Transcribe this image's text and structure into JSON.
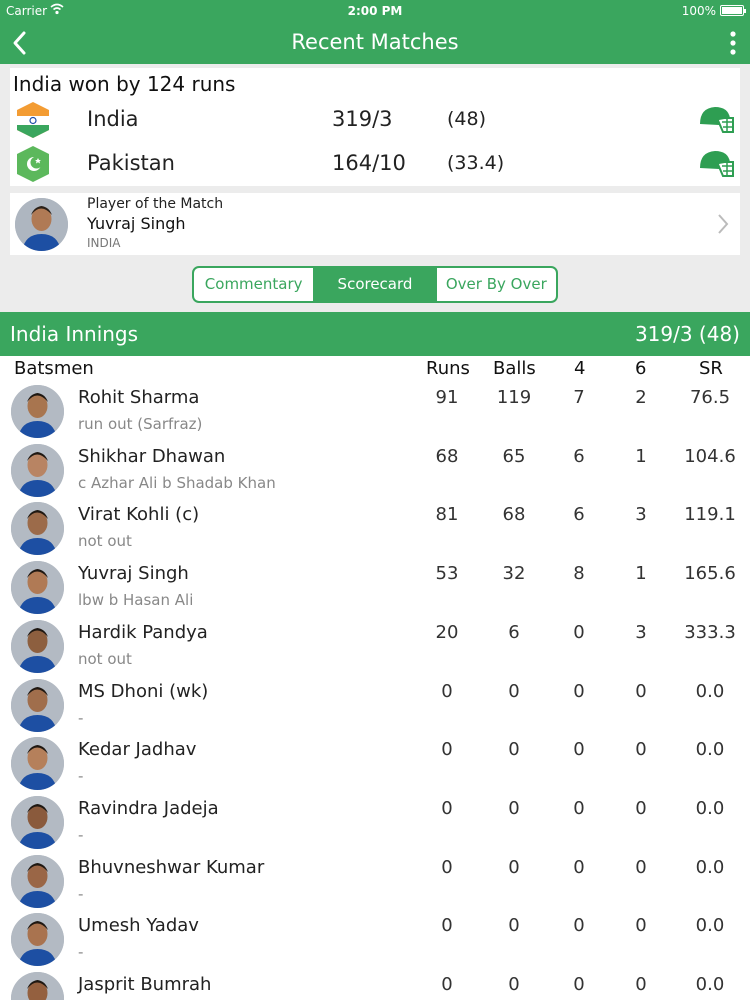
{
  "status_bar": {
    "carrier": "Carrier",
    "time": "2:00 PM",
    "battery": "100%"
  },
  "nav": {
    "title": "Recent Matches"
  },
  "result": {
    "title": "India won by 124 runs",
    "teams": [
      {
        "name": "India",
        "score": "319/3",
        "overs": "(48)"
      },
      {
        "name": "Pakistan",
        "score": "164/10",
        "overs": "(33.4)"
      }
    ]
  },
  "player_of_match": {
    "label": "Player of the Match",
    "name": "Yuvraj Singh",
    "country": "INDIA"
  },
  "tabs": [
    "Commentary",
    "Scorecard",
    "Over By Over"
  ],
  "active_tab": "Scorecard",
  "innings": {
    "title": "India Innings",
    "score": "319/3 (48)"
  },
  "table_header": {
    "batsmen": "Batsmen",
    "runs": "Runs",
    "balls": "Balls",
    "fours": "4",
    "sixes": "6",
    "sr": "SR"
  },
  "batsmen": [
    {
      "name": "Rohit Sharma",
      "dismissal": "run out (Sarfraz)",
      "runs": "91",
      "balls": "119",
      "fours": "7",
      "sixes": "2",
      "sr": "76.5"
    },
    {
      "name": "Shikhar Dhawan",
      "dismissal": "c Azhar Ali b Shadab Khan",
      "runs": "68",
      "balls": "65",
      "fours": "6",
      "sixes": "1",
      "sr": "104.6"
    },
    {
      "name": "Virat Kohli (c)",
      "dismissal": "not out",
      "runs": "81",
      "balls": "68",
      "fours": "6",
      "sixes": "3",
      "sr": "119.1"
    },
    {
      "name": "Yuvraj Singh",
      "dismissal": "lbw b Hasan Ali",
      "runs": "53",
      "balls": "32",
      "fours": "8",
      "sixes": "1",
      "sr": "165.6"
    },
    {
      "name": "Hardik Pandya",
      "dismissal": "not out",
      "runs": "20",
      "balls": "6",
      "fours": "0",
      "sixes": "3",
      "sr": "333.3"
    },
    {
      "name": "MS Dhoni (wk)",
      "dismissal": "-",
      "runs": "0",
      "balls": "0",
      "fours": "0",
      "sixes": "0",
      "sr": "0.0"
    },
    {
      "name": "Kedar Jadhav",
      "dismissal": "-",
      "runs": "0",
      "balls": "0",
      "fours": "0",
      "sixes": "0",
      "sr": "0.0"
    },
    {
      "name": "Ravindra Jadeja",
      "dismissal": "-",
      "runs": "0",
      "balls": "0",
      "fours": "0",
      "sixes": "0",
      "sr": "0.0"
    },
    {
      "name": "Bhuvneshwar Kumar",
      "dismissal": "-",
      "runs": "0",
      "balls": "0",
      "fours": "0",
      "sixes": "0",
      "sr": "0.0"
    },
    {
      "name": "Umesh Yadav",
      "dismissal": "-",
      "runs": "0",
      "balls": "0",
      "fours": "0",
      "sixes": "0",
      "sr": "0.0"
    },
    {
      "name": "Jasprit  Bumrah",
      "dismissal": "",
      "runs": "0",
      "balls": "0",
      "fours": "0",
      "sixes": "0",
      "sr": "0.0"
    }
  ],
  "colors": {
    "brand_green": "#3aa65e",
    "india_saffron": "#f39c33",
    "pakistan_green": "#5cb85c",
    "helmet_green": "#2e9e52"
  },
  "icons": {
    "back": "chevron-left-icon",
    "more": "more-vertical-icon",
    "team_flag": "shield-flag-icon",
    "helmet": "cricket-helmet-icon",
    "pom_chevron": "chevron-right-icon"
  }
}
